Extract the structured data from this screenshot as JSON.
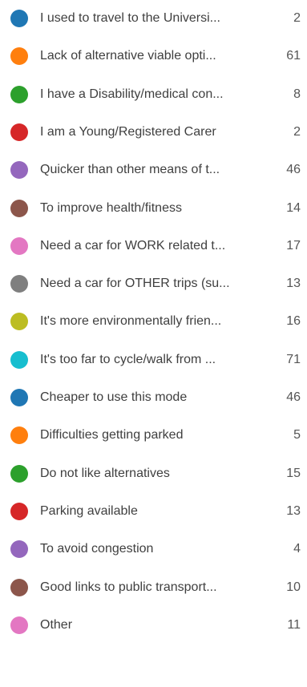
{
  "chart_data": {
    "type": "pie",
    "legend_position": "list",
    "categories": [
      "I used to travel to the Universi...",
      "Lack of alternative viable opti...",
      "I have a Disability/medical con...",
      "I am a Young/Registered Carer",
      "Quicker than other means of t...",
      "To improve health/fitness",
      "Need a car for WORK related t...",
      "Need a car for OTHER trips (su...",
      "It's more environmentally frien...",
      "It's too far to cycle/walk from ...",
      "Cheaper to use this mode",
      "Difficulties getting parked",
      "Do not like alternatives",
      "Parking available",
      "To avoid congestion",
      "Good links to public transport...",
      "Other"
    ],
    "values": [
      2,
      61,
      8,
      2,
      46,
      14,
      17,
      13,
      16,
      71,
      46,
      5,
      15,
      13,
      4,
      10,
      11
    ],
    "colors": [
      "#1f77b4",
      "#ff7f0e",
      "#2ca02c",
      "#d62728",
      "#9467bd",
      "#8c564b",
      "#e377c2",
      "#7f7f7f",
      "#bcbd22",
      "#17becf",
      "#1f77b4",
      "#ff7f0e",
      "#2ca02c",
      "#d62728",
      "#9467bd",
      "#8c564b",
      "#e377c2"
    ]
  }
}
